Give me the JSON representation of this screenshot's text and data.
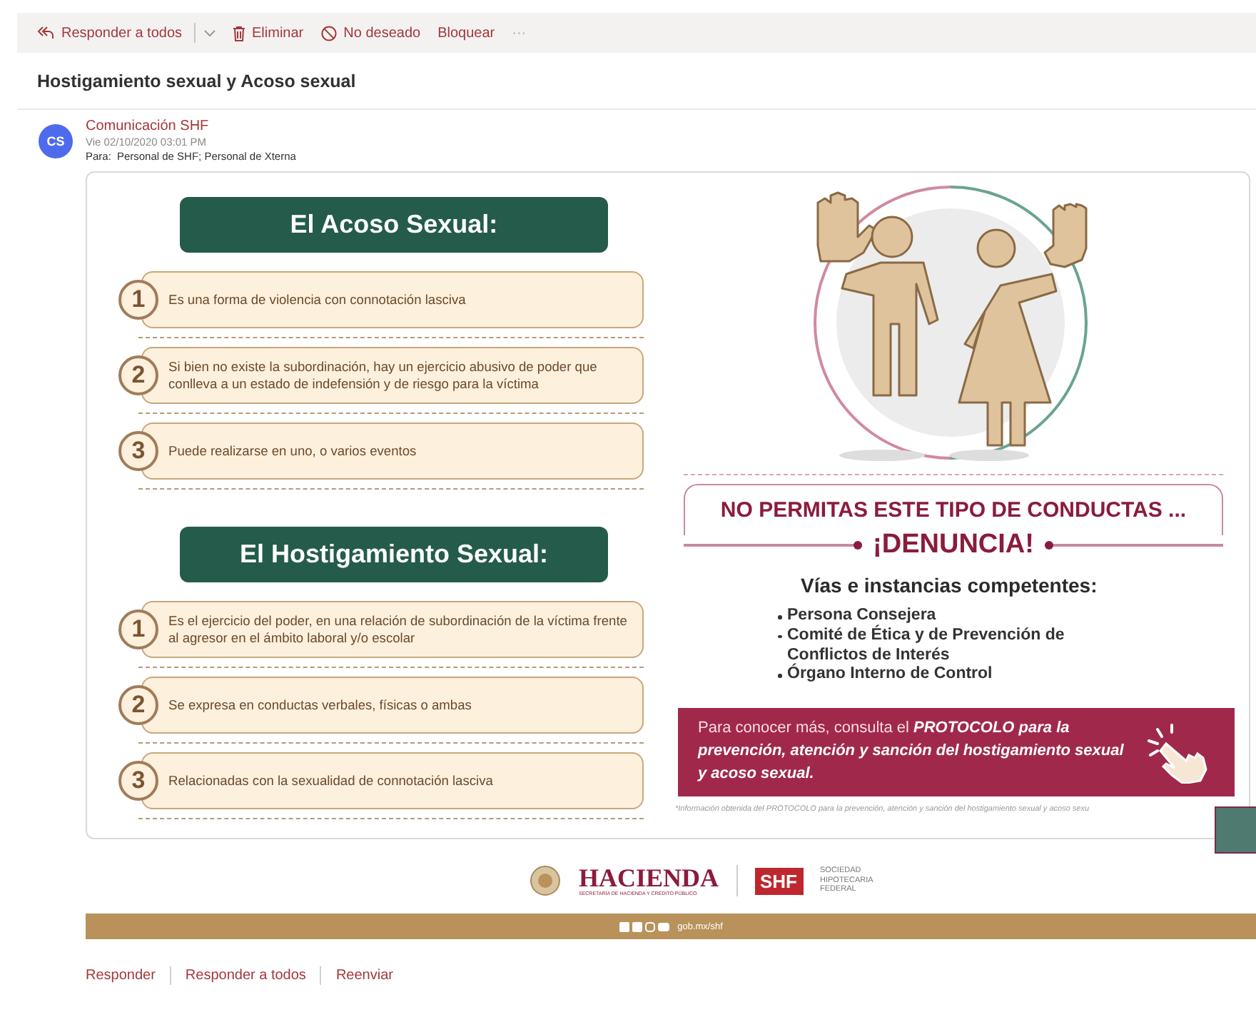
{
  "toolbar": {
    "buttons": [
      {
        "kind": "reply-all",
        "label": "Responder a todos"
      },
      {
        "kind": "delete",
        "label": "Eliminar"
      },
      {
        "kind": "junk",
        "label": "No deseado"
      },
      {
        "kind": "block",
        "label": "Bloquear"
      },
      {
        "kind": "more",
        "label": "···"
      }
    ]
  },
  "subject": "Hostigamiento sexual y Acoso sexual",
  "message": {
    "avatar": "CS",
    "sender": "Comunicación SHF",
    "date": "Vie 02/10/2020 03:01 PM",
    "to_label": "Para:",
    "to": "Personal de SHF; Personal de Xterna"
  },
  "infographic": {
    "sections": [
      {
        "title": "El Acoso Sexual:",
        "points": [
          {
            "number": "1",
            "text": "Es una forma de violencia con connotación lasciva"
          },
          {
            "number": "2",
            "text": "Si bien no existe la subordinación, hay un ejercicio  abusivo de poder que conlleva a un estado de indefensión y de riesgo para la víctima"
          },
          {
            "number": "3",
            "text": "Puede realizarse en uno, o varios eventos"
          }
        ]
      },
      {
        "title": "El Hostigamiento Sexual:",
        "points": [
          {
            "number": "1",
            "text": "Es el ejercicio del poder, en una relación de subordinación de la víctima frente al agresor en el ámbito laboral y/o escolar"
          },
          {
            "number": "2",
            "text": "Se expresa en conductas verbales, físicas o ambas"
          },
          {
            "number": "3",
            "text": "Relacionadas con la sexualidad de connotación lasciva"
          }
        ]
      }
    ],
    "warning": "NO PERMITAS ESTE TIPO DE CONDUCTAS ...",
    "call": "¡DENUNCIA!",
    "channels_title": "Vías e instancias competentes:",
    "channels": [
      "Persona Consejera",
      "Comité de Ética y de Prevención de Conflictos de Interés",
      "Órgano Interno de Control"
    ],
    "protocol_note": "Para conocer más, consulta el **PROTOCOLO para la prevención, atención y sanción del hostigamiento sexual y acoso sexual.**",
    "footnote": "*Información obtenida del  PROTOCOLO para la prevención, atención y sanción del hostigamiento sexual y acoso sexu"
  },
  "footer": {
    "hacienda": "HACIENDA",
    "hacienda_sub": "SECRETARÍA DE HACIENDA Y CRÉDITO PÚBLICO",
    "shf_logo": "SHF",
    "shf_name": "SOCIEDAD HIPOTECARIA FEDERAL",
    "website": "gob.mx/shf"
  },
  "actions": [
    "Responder",
    "Responder a todos",
    "Reenviar"
  ]
}
